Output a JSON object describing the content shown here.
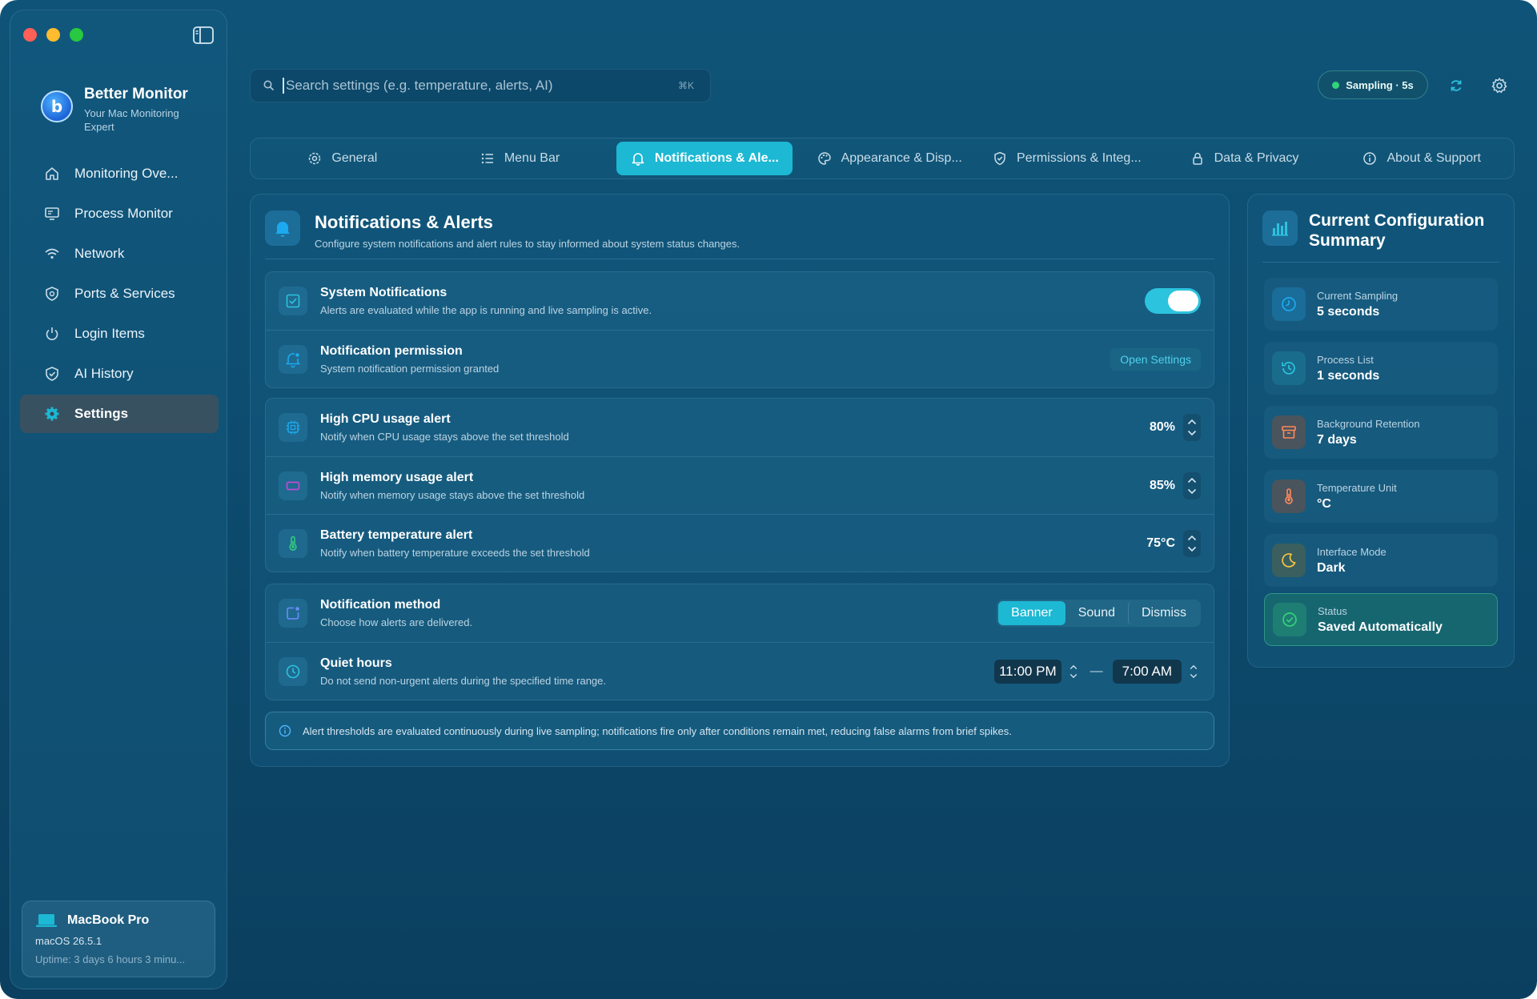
{
  "app": {
    "name": "Better Monitor",
    "tagline": "Your Mac Monitoring Expert"
  },
  "sidebar": {
    "items": [
      {
        "label": "Monitoring Ove...",
        "icon": "home-icon"
      },
      {
        "label": "Process Monitor",
        "icon": "monitor-icon"
      },
      {
        "label": "Network",
        "icon": "wifi-icon"
      },
      {
        "label": "Ports & Services",
        "icon": "shield-icon"
      },
      {
        "label": "Login Items",
        "icon": "power-icon"
      },
      {
        "label": "AI History",
        "icon": "shield-check-icon"
      },
      {
        "label": "Settings",
        "icon": "gear-icon",
        "active": true
      }
    ],
    "device": {
      "name": "MacBook Pro",
      "os": "macOS 26.5.1",
      "uptime": "Uptime: 3 days 6 hours 3 minu..."
    }
  },
  "search": {
    "placeholder": "Search settings (e.g. temperature, alerts, AI)",
    "shortcut": "⌘K"
  },
  "sampling_badge": "Sampling · 5s",
  "tabs": [
    {
      "label": "General",
      "icon": "gear-icon"
    },
    {
      "label": "Menu Bar",
      "icon": "list-icon"
    },
    {
      "label": "Notifications & Ale...",
      "icon": "bell-icon",
      "active": true
    },
    {
      "label": "Appearance & Disp...",
      "icon": "palette-icon"
    },
    {
      "label": "Permissions & Integ...",
      "icon": "shield-check-icon"
    },
    {
      "label": "Data & Privacy",
      "icon": "lock-icon"
    },
    {
      "label": "About & Support",
      "icon": "info-icon"
    }
  ],
  "main": {
    "title": "Notifications & Alerts",
    "description": "Configure system notifications and alert rules to stay informed about system status changes.",
    "system_notifications": {
      "title": "System Notifications",
      "description": "Alerts are evaluated while the app is running and live sampling is active.",
      "enabled": true
    },
    "permission": {
      "title": "Notification permission",
      "description": "System notification permission granted",
      "button": "Open Settings"
    },
    "alerts": [
      {
        "title": "High CPU usage alert",
        "description": "Notify when CPU usage stays above the set threshold",
        "value": "80%"
      },
      {
        "title": "High memory usage alert",
        "description": "Notify when memory usage stays above the set threshold",
        "value": "85%"
      },
      {
        "title": "Battery temperature alert",
        "description": "Notify when battery temperature exceeds the set threshold",
        "value": "75°C"
      }
    ],
    "method": {
      "title": "Notification method",
      "description": "Choose how alerts are delivered.",
      "options": [
        "Banner",
        "Sound",
        "Dismiss"
      ],
      "selected": "Banner"
    },
    "quiet": {
      "title": "Quiet hours",
      "description": "Do not send non-urgent alerts during the specified time range.",
      "start": "11:00 PM",
      "end": "7:00 AM",
      "separator": "—"
    },
    "info": "Alert thresholds are evaluated continuously during live sampling; notifications fire only after conditions remain met, reducing false alarms from brief spikes."
  },
  "summary": {
    "title": "Current Configuration Summary",
    "items": [
      {
        "label": "Current Sampling",
        "value": "5 seconds",
        "icon": "clock-icon"
      },
      {
        "label": "Process List",
        "value": "1 seconds",
        "icon": "history-icon"
      },
      {
        "label": "Background Retention",
        "value": "7 days",
        "icon": "archive-icon"
      },
      {
        "label": "Temperature Unit",
        "value": "°C",
        "icon": "thermometer-icon"
      },
      {
        "label": "Interface Mode",
        "value": "Dark",
        "icon": "moon-icon"
      },
      {
        "label": "Status",
        "value": "Saved Automatically",
        "icon": "check-circle-icon"
      }
    ]
  },
  "colors": {
    "accent": "#1cb8d4",
    "background": "#0d4d70",
    "status_green": "#33d17a"
  }
}
